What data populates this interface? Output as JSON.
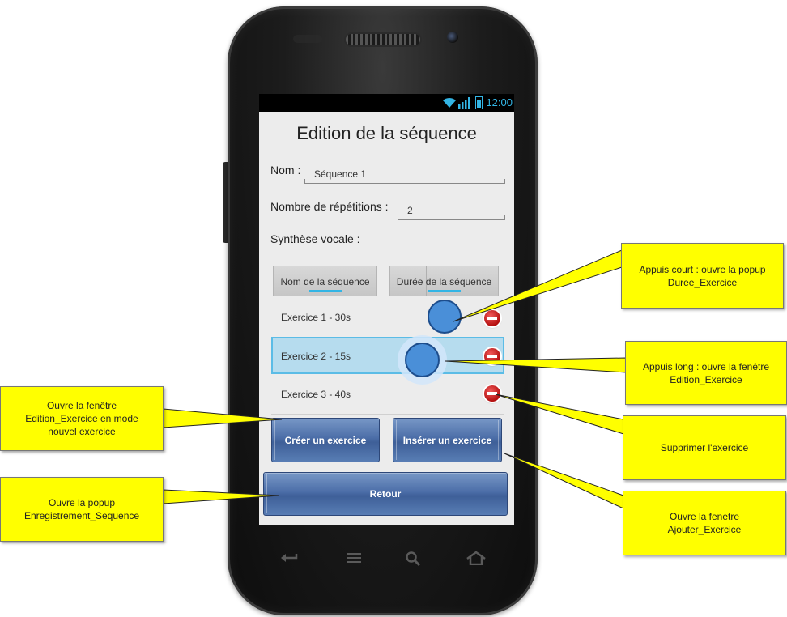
{
  "status": {
    "time": "12:00"
  },
  "screen": {
    "title": "Edition de la séquence",
    "name_label": "Nom :",
    "name_value": "Séquence 1",
    "repetitions_label": "Nombre de répétitions :",
    "repetitions_value": "2",
    "synth_label": "Synthèse vocale :",
    "toggles": [
      "Nom de la séquence",
      "Durée de la séquence"
    ],
    "exercises": [
      {
        "label": "Exercice 1 - 30s"
      },
      {
        "label": "Exercice 2 - 15s",
        "selected": true
      },
      {
        "label": "Exercice 3 - 40s"
      }
    ],
    "create_button": "Créer un exercice",
    "insert_button": "Insérer un exercice",
    "back_button": "Retour"
  },
  "callouts": {
    "short_press": "Appuis court : ouvre la popup\nDuree_Exercice",
    "long_press": "Appuis long : ouvre la fenêtre\nEdition_Exercice",
    "delete": "Supprimer l'exercice",
    "insert": "Ouvre la fenetre\nAjouter_Exercice",
    "create": "Ouvre la fenêtre\nEdition_Exercice en mode\nnouvel exercice",
    "back": "Ouvre la popup\nEnregistrement_Sequence"
  },
  "colors": {
    "accent": "#33b5e5",
    "callout": "#ffff00",
    "button": "#4c6ea8",
    "delete": "#d21c1c"
  },
  "icons": [
    "wifi-icon",
    "signal-icon",
    "battery-icon",
    "back-nav-icon",
    "menu-nav-icon",
    "search-nav-icon",
    "home-nav-icon",
    "delete-icon"
  ]
}
